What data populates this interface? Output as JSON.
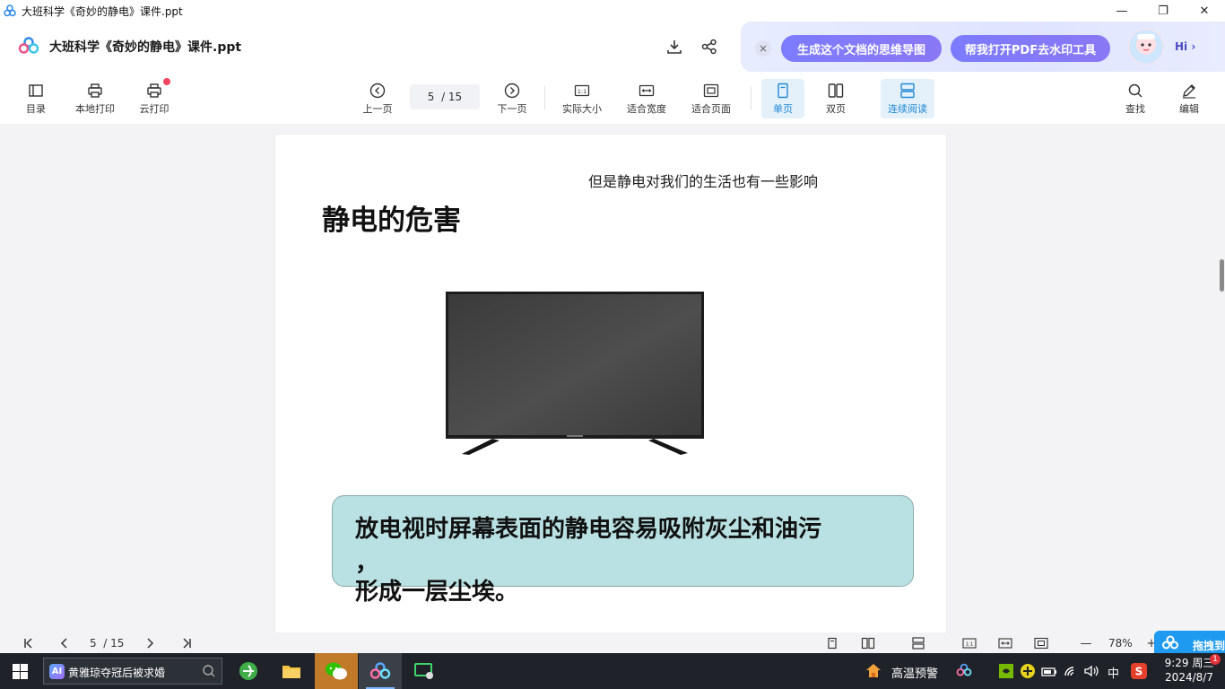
{
  "window": {
    "title": "大班科学《奇妙的静电》课件.ppt",
    "controls": [
      "—",
      "❐",
      "✕"
    ]
  },
  "header": {
    "doc_title": "大班科学《奇妙的静电》课件.ppt",
    "ai_close": "×",
    "ai_pill_1": "生成这个文档的思维导图",
    "ai_pill_2": "帮我打开PDF去水印工具",
    "ai_hi": "Hi ›"
  },
  "toolbar": {
    "toc": "目录",
    "local_print": "本地打印",
    "cloud_print": "云打印",
    "prev_page": "上一页",
    "page_current": "5",
    "page_total": "/ 15",
    "next_page": "下一页",
    "actual_size": "实际大小",
    "fit_width": "适合宽度",
    "fit_page": "适合页面",
    "single_page": "单页",
    "double_page": "双页",
    "continuous": "连续阅读",
    "find": "查找",
    "edit": "编辑"
  },
  "slide": {
    "subtitle": "但是静电对我们的生活也有一些影响",
    "heading": "静电的危害",
    "callout_line1": "放电视时屏幕表面的静电容易吸附灰尘和油污",
    "callout_line2": "，",
    "callout_line3": "形成一层尘埃。"
  },
  "statusbar": {
    "page_current": "5",
    "page_total": "/ 15",
    "zoom": "78%",
    "zoom_minus": "—",
    "zoom_plus": "+",
    "promo": "拖拽到"
  },
  "taskbar": {
    "search_badge": "AI",
    "search_query": "黄雅琼夺冠后被求婚",
    "weather": "高温预警",
    "ime": "中",
    "time": "9:29 周三",
    "date": "2024/8/7",
    "notification_count": "1"
  },
  "colors": {
    "accent": "#1f88d6",
    "callout_bg": "#b9e0e2",
    "ai_pill": "#7c7bff"
  }
}
